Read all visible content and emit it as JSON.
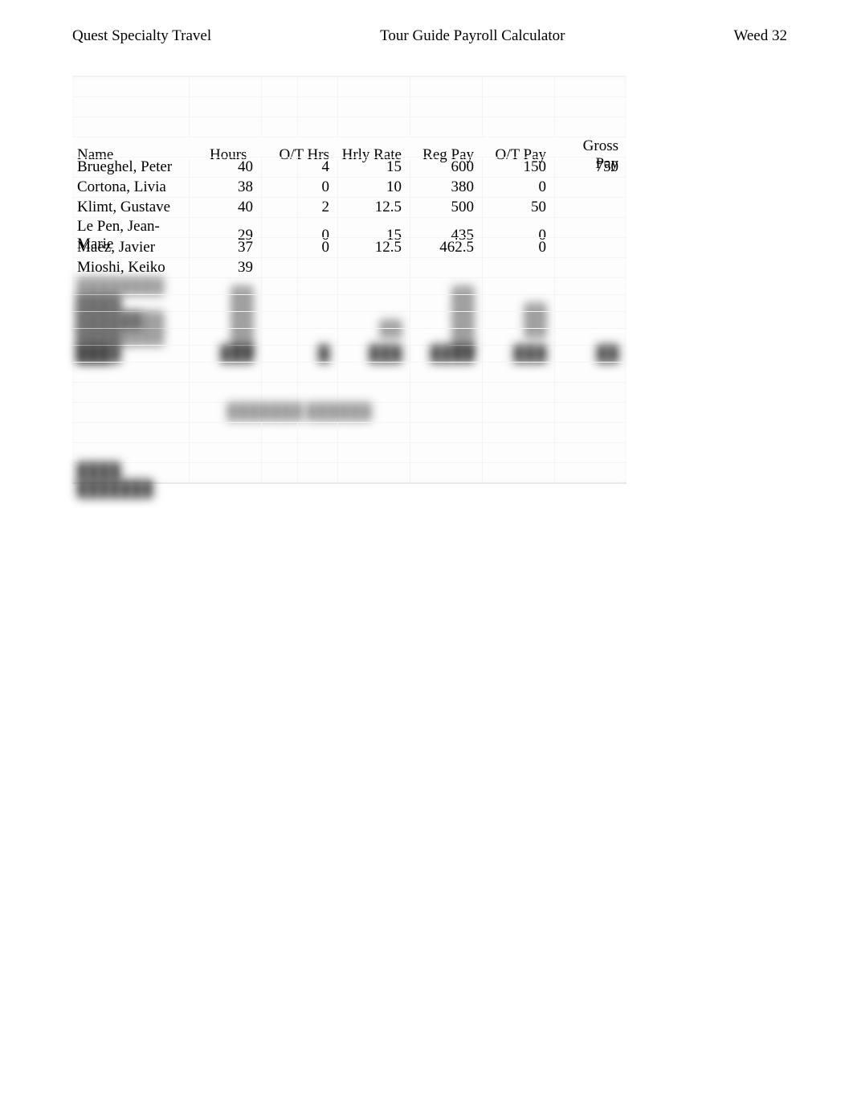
{
  "header": {
    "left": "Quest Specialty Travel",
    "center": "Tour Guide Payroll Calculator",
    "right": "Weed 32"
  },
  "table": {
    "columns": [
      "Name",
      "Hours",
      "O/T Hrs",
      "Hrly  Rate",
      "Reg  Pay",
      "O/T Pay",
      "Gross Pay"
    ],
    "rows": [
      {
        "name": "Brueghel, Peter",
        "hours": "40",
        "ot_hrs": "4",
        "hrly_rate": "15",
        "reg_pay": "600",
        "ot_pay": "150",
        "gross_pay": "750"
      },
      {
        "name": "Cortona, Livia",
        "hours": "38",
        "ot_hrs": "0",
        "hrly_rate": "10",
        "reg_pay": "380",
        "ot_pay": "0",
        "gross_pay": ""
      },
      {
        "name": "Klimt, Gustave",
        "hours": "40",
        "ot_hrs": "2",
        "hrly_rate": "12.5",
        "reg_pay": "500",
        "ot_pay": "50",
        "gross_pay": ""
      },
      {
        "name": "Le Pen, Jean-Marie",
        "hours": "29",
        "ot_hrs": "0",
        "hrly_rate": "15",
        "reg_pay": "435",
        "ot_pay": "0",
        "gross_pay": ""
      },
      {
        "name": "Maez, Javier",
        "hours": "37",
        "ot_hrs": "0",
        "hrly_rate": "12.5",
        "reg_pay": "462.5",
        "ot_pay": "0",
        "gross_pay": ""
      },
      {
        "name": "Mioshi, Keiko",
        "hours": "39",
        "ot_hrs": "",
        "hrly_rate": "",
        "reg_pay": "",
        "ot_pay": "",
        "gross_pay": ""
      }
    ],
    "blurred_rows": [
      {
        "name": "████████ ████",
        "hours": "██",
        "ot_hrs": "",
        "hrly_rate": "",
        "reg_pay": "██",
        "ot_pay": "",
        "gross_pay": ""
      },
      {
        "name": "████ ██████",
        "hours": "██",
        "ot_hrs": "",
        "hrly_rate": "",
        "reg_pay": "██",
        "ot_pay": "██",
        "gross_pay": ""
      },
      {
        "name": "████████ ████",
        "hours": "██",
        "ot_hrs": "",
        "hrly_rate": "██",
        "reg_pay": "██",
        "ot_pay": "██",
        "gross_pay": ""
      },
      {
        "name": "████████ ███",
        "hours": "██",
        "ot_hrs": "",
        "hrly_rate": "",
        "reg_pay": "██",
        "ot_pay": "",
        "gross_pay": ""
      },
      {
        "name": "████",
        "hours": "███",
        "ot_hrs": "█",
        "hrly_rate": "███",
        "reg_pay": "████",
        "ot_pay": "███",
        "gross_pay": "██"
      }
    ],
    "mid_label": "███████ ██████",
    "footer_label": "████ ███████"
  }
}
